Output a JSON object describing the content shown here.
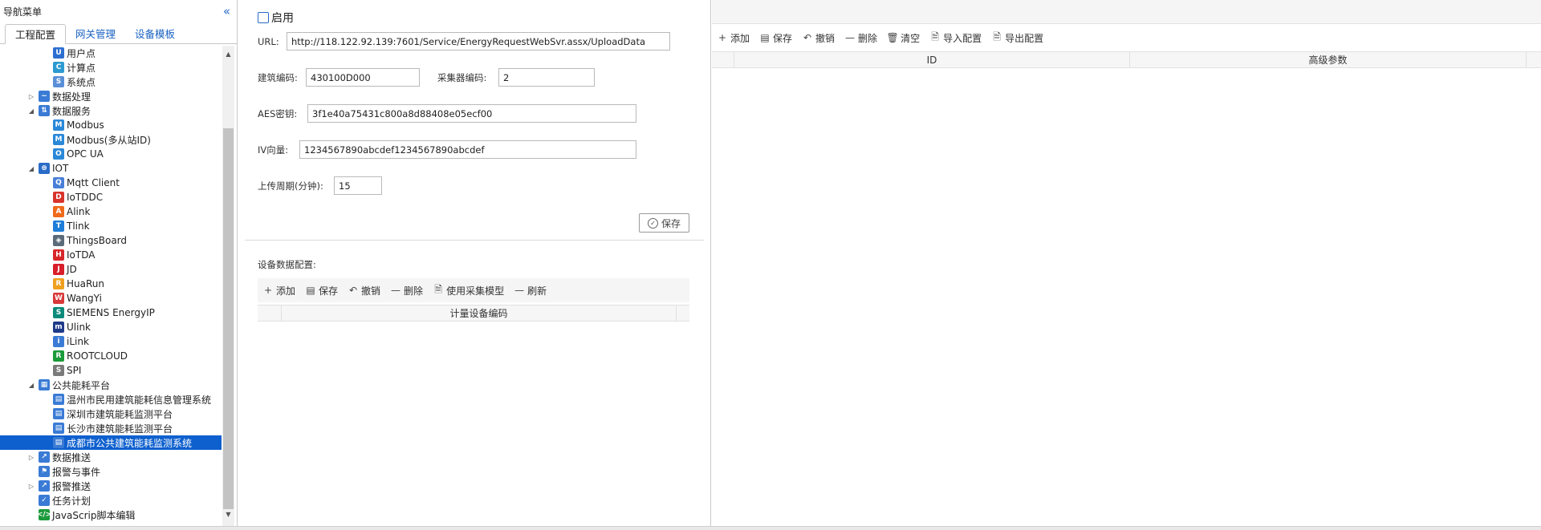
{
  "nav": {
    "title": "导航菜单",
    "collapse_icon": "double-chevron-left-icon",
    "tabs": [
      "工程配置",
      "网关管理",
      "设备模板"
    ],
    "tree": [
      {
        "label": "用户点",
        "level": 2,
        "icon": "user-point-icon",
        "color": "#2d6fd1"
      },
      {
        "label": "计算点",
        "level": 2,
        "icon": "calc-point-icon",
        "color": "#2d9bd1"
      },
      {
        "label": "系统点",
        "level": 2,
        "icon": "system-point-icon",
        "color": "#5a8fd8"
      },
      {
        "label": "数据处理",
        "level": 1,
        "arrow": "right",
        "icon": "data-process-icon",
        "color": "#3a7bd5"
      },
      {
        "label": "数据服务",
        "level": 1,
        "arrow": "down",
        "icon": "data-service-icon",
        "color": "#3a7bd5"
      },
      {
        "label": "Modbus",
        "level": 2,
        "icon": "modbus-icon",
        "color": "#2a88d8"
      },
      {
        "label": "Modbus(多从站ID)",
        "level": 2,
        "icon": "modbus-multi-icon",
        "color": "#2a88d8"
      },
      {
        "label": "OPC UA",
        "level": 2,
        "icon": "opc-ua-icon",
        "color": "#2a88d8"
      },
      {
        "label": "IOT",
        "level": 1,
        "arrow": "down",
        "icon": "iot-icon",
        "color": "#2a6cc8"
      },
      {
        "label": "Mqtt Client",
        "level": 2,
        "icon": "mqtt-icon",
        "color": "#4a7fd8"
      },
      {
        "label": "IoTDDC",
        "level": 2,
        "icon": "iotddc-icon",
        "color": "#d8342c"
      },
      {
        "label": "Alink",
        "level": 2,
        "icon": "alink-icon",
        "color": "#ef6a1a"
      },
      {
        "label": "Tlink",
        "level": 2,
        "icon": "tlink-icon",
        "color": "#1f7ed8"
      },
      {
        "label": "ThingsBoard",
        "level": 2,
        "icon": "thingsboard-icon",
        "color": "#5b6b7a"
      },
      {
        "label": "IoTDA",
        "level": 2,
        "icon": "iotda-icon",
        "color": "#d8262a"
      },
      {
        "label": "JD",
        "level": 2,
        "icon": "jd-icon",
        "color": "#d81e2a"
      },
      {
        "label": "HuaRun",
        "level": 2,
        "icon": "huarun-icon",
        "color": "#f0a020"
      },
      {
        "label": "WangYi",
        "level": 2,
        "icon": "wangyi-icon",
        "color": "#d83a3a"
      },
      {
        "label": "SIEMENS EnergyIP",
        "level": 2,
        "icon": "siemens-icon",
        "color": "#0b8a7a"
      },
      {
        "label": "Ulink",
        "level": 2,
        "icon": "ulink-icon",
        "color": "#1e3a8a"
      },
      {
        "label": "iLink",
        "level": 2,
        "icon": "ilink-icon",
        "color": "#3a7bd5"
      },
      {
        "label": "ROOTCLOUD",
        "level": 2,
        "icon": "rootcloud-icon",
        "color": "#1b9a3a"
      },
      {
        "label": "SPI",
        "level": 2,
        "icon": "spi-icon",
        "color": "#7a7a7a"
      },
      {
        "label": "公共能耗平台",
        "level": 1,
        "arrow": "down",
        "icon": "energy-platform-icon",
        "color": "#3a7bd5"
      },
      {
        "label": "温州市民用建筑能耗信息管理系统",
        "level": 2,
        "icon": "building-icon",
        "color": "#3a7bd5"
      },
      {
        "label": "深圳市建筑能耗监测平台",
        "level": 2,
        "icon": "building-icon",
        "color": "#3a7bd5"
      },
      {
        "label": "长沙市建筑能耗监测平台",
        "level": 2,
        "icon": "building-icon",
        "color": "#3a7bd5"
      },
      {
        "label": "成都市公共建筑能耗监测系统",
        "level": 2,
        "icon": "building-icon",
        "color": "#3a7bd5",
        "selected": true
      },
      {
        "label": "数据推送",
        "level": 1,
        "arrow": "right",
        "icon": "data-push-icon",
        "color": "#3a7bd5"
      },
      {
        "label": "报警与事件",
        "level": 1,
        "icon": "alarm-bell-icon",
        "color": "#3a7bd5"
      },
      {
        "label": "报警推送",
        "level": 1,
        "arrow": "right",
        "icon": "alarm-push-icon",
        "color": "#3a7bd5"
      },
      {
        "label": "任务计划",
        "level": 1,
        "icon": "task-plan-icon",
        "color": "#3a7bd5"
      },
      {
        "label": "JavaScrip脚本编辑",
        "level": 1,
        "icon": "script-icon",
        "color": "#1b9a3a"
      }
    ]
  },
  "form": {
    "enable_label": "启用",
    "enabled": false,
    "url_label": "URL:",
    "url_value": "http://118.122.92.139:7601/Service/EnergyRequestWebSvr.assx/UploadData",
    "building_code_label": "建筑编码:",
    "building_code_value": "430100D000",
    "collector_code_label": "采集器编码:",
    "collector_code_value": "2",
    "aes_key_label": "AES密钥:",
    "aes_key_value": "3f1e40a75431c800a8d88408e05ecf00",
    "iv_label": "IV向量:",
    "iv_value": "1234567890abcdef1234567890abcdef",
    "upload_period_label": "上传周期(分钟):",
    "upload_period_value": "15",
    "save_label": "保存"
  },
  "device_section": {
    "title": "设备数据配置:",
    "toolbar": [
      "添加",
      "保存",
      "撤销",
      "删除",
      "使用采集模型",
      "刷新"
    ],
    "columns": [
      "计量设备编码"
    ]
  },
  "right_panel": {
    "toolbar": [
      "添加",
      "保存",
      "撤销",
      "删除",
      "清空",
      "导入配置",
      "导出配置"
    ],
    "columns": [
      "ID",
      "高级参数"
    ]
  }
}
